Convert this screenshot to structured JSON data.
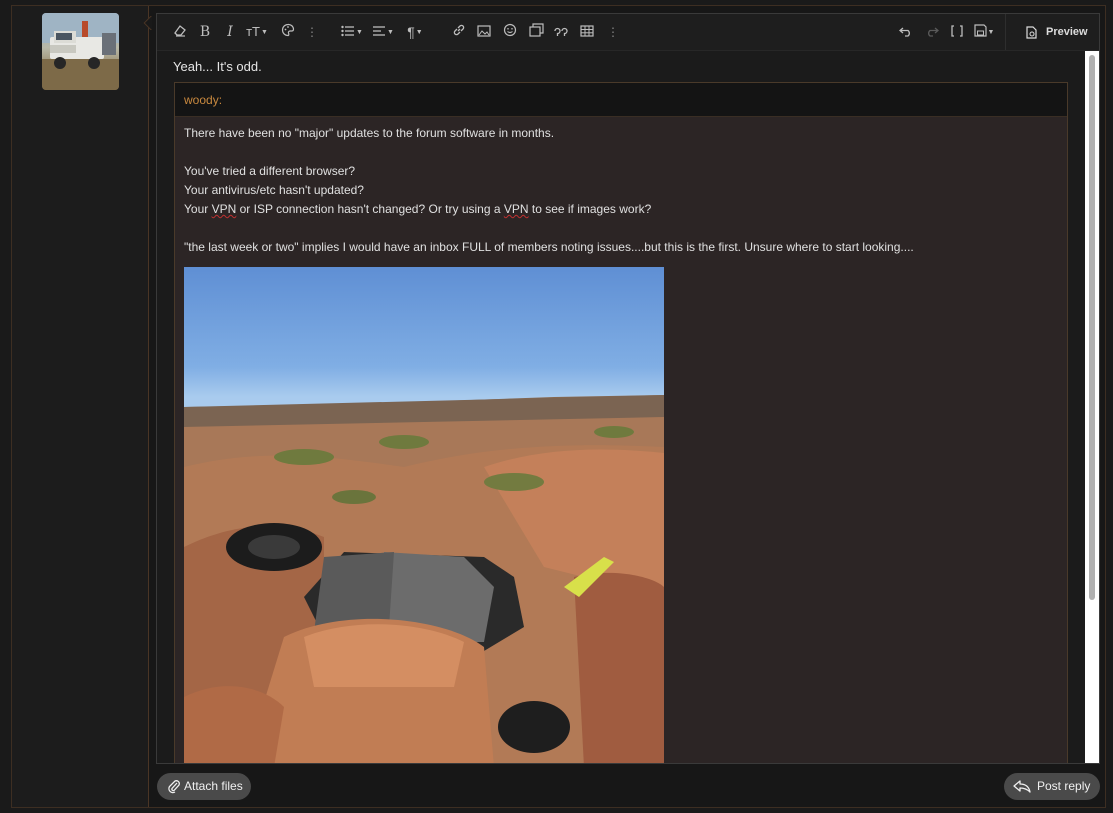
{
  "reply": {
    "text": "Yeah... It's odd."
  },
  "quote": {
    "author": "woody:",
    "lines": [
      "There have been no \"major\" updates to the forum software in months.",
      "You've tried a different browser?",
      "Your antivirus/etc hasn't updated?",
      "\"the last week or two\" implies I would have an inbox FULL of members noting issues....but this is the first. Unsure where to start looking...."
    ],
    "vpn_line": {
      "p1": "Your ",
      "w1": "VPN",
      "p2": " or ISP connection hasn't changed? Or try using a ",
      "w2": "VPN",
      "p3": " to see if images work?"
    }
  },
  "toolbar": {
    "icons": [
      "eraser-icon",
      "bold-icon",
      "italic-icon",
      "text-size-icon",
      "palette-icon",
      "more-icon",
      "list-icon",
      "align-icon",
      "paragraph-icon",
      "link-icon",
      "image-icon",
      "smiley-icon",
      "media-icon",
      "quote-icon",
      "table-icon",
      "more-icon",
      "undo-icon",
      "redo-icon",
      "bbcode-icon",
      "drafts-icon"
    ],
    "bold_glyph": "B",
    "italic_glyph": "I",
    "text_size_glyph": "тТ",
    "paragraph_glyph": "¶",
    "more_glyph": "⋮",
    "preview_label": "Preview"
  },
  "actions": {
    "attach_label": "Attach files",
    "post_label": "Post reply"
  },
  "colors": {
    "quote_author": "#c9893f",
    "quote_bg": "#2c2525",
    "button_bg": "#4a4a4a"
  }
}
